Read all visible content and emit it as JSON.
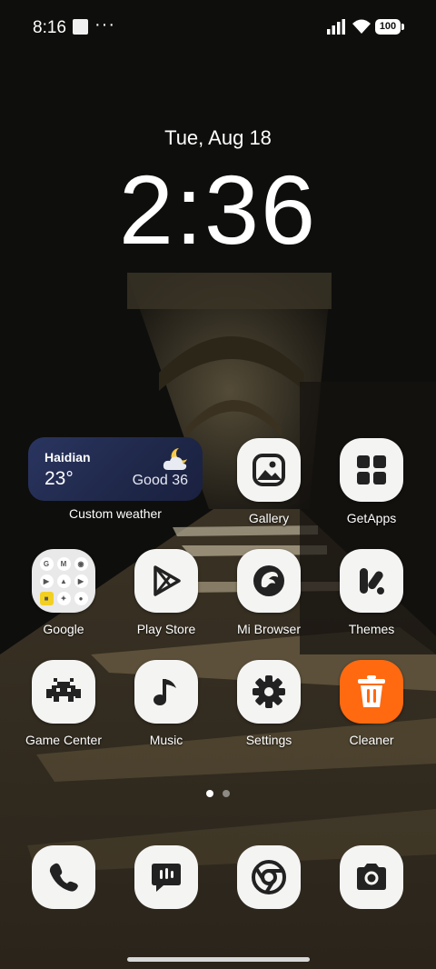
{
  "status_bar": {
    "time": "8:16",
    "overflow": "···",
    "battery": "100"
  },
  "lockscreen": {
    "date": "Tue, Aug 18",
    "time": "2:36"
  },
  "weather_widget": {
    "city": "Haidian",
    "temperature": "23°",
    "air_quality": "Good 36",
    "label": "Custom weather",
    "icon": "partly-cloudy-night-icon"
  },
  "apps": {
    "gallery": "Gallery",
    "getapps": "GetApps",
    "google": "Google",
    "play_store": "Play Store",
    "mi_browser": "Mi Browser",
    "themes": "Themes",
    "game_center": "Game Center",
    "music": "Music",
    "settings": "Settings",
    "cleaner": "Cleaner"
  },
  "google_folder_icons": [
    "G",
    "M",
    "◉",
    "▶",
    "▲",
    "▶",
    "■",
    "✦",
    "●"
  ],
  "dock": [
    "phone-icon",
    "messages-icon",
    "chrome-icon",
    "camera-icon"
  ],
  "colors": {
    "cleaner_accent": "#ff6a10",
    "icon_background": "#f4f4f3",
    "weather_widget": "#232c52"
  }
}
